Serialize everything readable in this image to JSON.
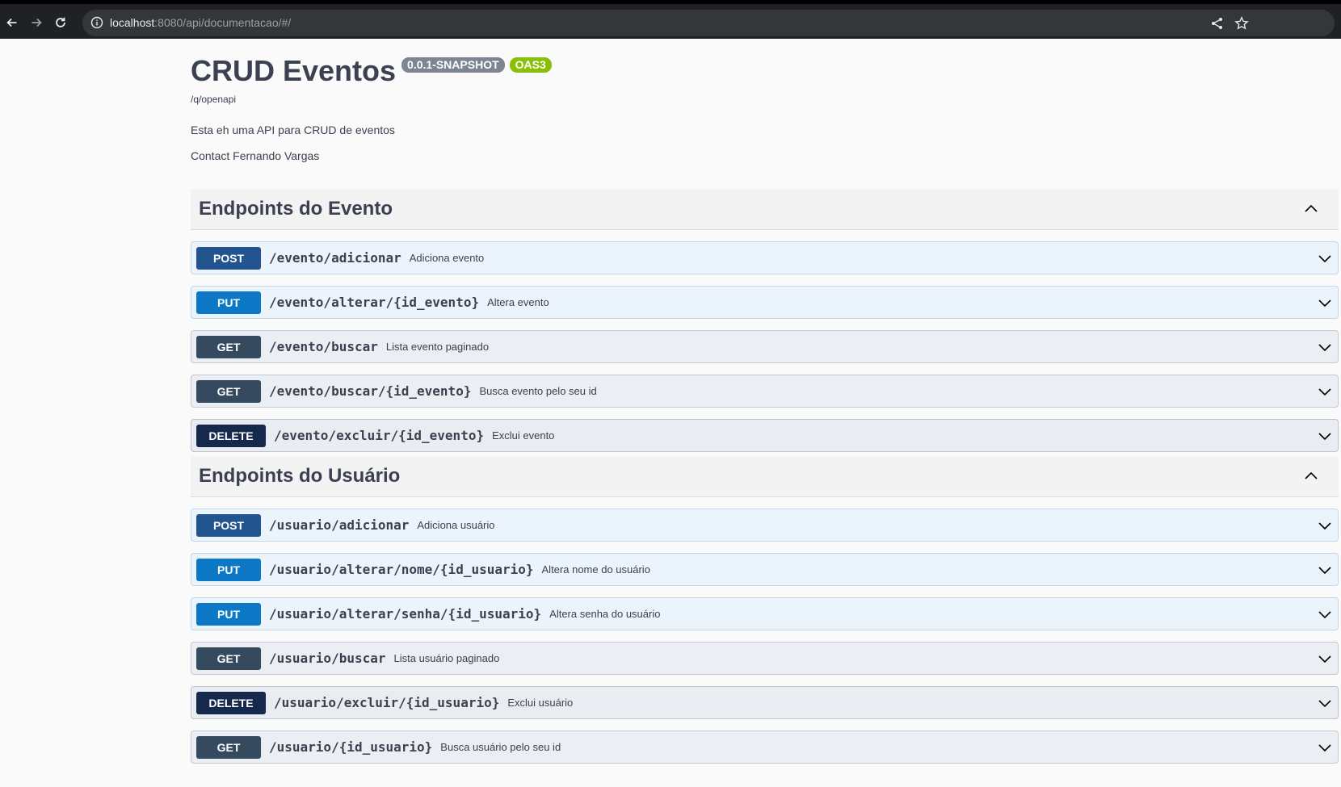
{
  "browser": {
    "url_host": "localhost",
    "url_rest": ":8080/api/documentacao/#/"
  },
  "info": {
    "title": "CRUD Eventos",
    "version_badge": "0.0.1-SNAPSHOT",
    "oas_badge": "OAS3",
    "spec_url": "/q/openapi",
    "description": "Esta eh uma API para CRUD de eventos",
    "contact": "Contact Fernando Vargas"
  },
  "sections": [
    {
      "title": "Endpoints do Evento",
      "operations": [
        {
          "method": "POST",
          "path": "/evento/adicionar",
          "summary": "Adiciona evento"
        },
        {
          "method": "PUT",
          "path": "/evento/alterar/{id_evento}",
          "summary": "Altera evento"
        },
        {
          "method": "GET",
          "path": "/evento/buscar",
          "summary": "Lista evento paginado"
        },
        {
          "method": "GET",
          "path": "/evento/buscar/{id_evento}",
          "summary": "Busca evento pelo seu id"
        },
        {
          "method": "DELETE",
          "path": "/evento/excluir/{id_evento}",
          "summary": "Exclui evento"
        }
      ]
    },
    {
      "title": "Endpoints do Usuário",
      "operations": [
        {
          "method": "POST",
          "path": "/usuario/adicionar",
          "summary": "Adiciona usuário"
        },
        {
          "method": "PUT",
          "path": "/usuario/alterar/nome/{id_usuario}",
          "summary": "Altera nome do usuário"
        },
        {
          "method": "PUT",
          "path": "/usuario/alterar/senha/{id_usuario}",
          "summary": "Altera senha do usuário"
        },
        {
          "method": "GET",
          "path": "/usuario/buscar",
          "summary": "Lista usuário paginado"
        },
        {
          "method": "DELETE",
          "path": "/usuario/excluir/{id_usuario}",
          "summary": "Exclui usuário"
        },
        {
          "method": "GET",
          "path": "/usuario/{id_usuario}",
          "summary": "Busca usuário pelo seu id"
        }
      ]
    }
  ],
  "colors": {
    "post": "#22558f",
    "put": "#0d79c6",
    "get": "#354a5f",
    "delete": "#15294d",
    "version_badge": "#7d8492",
    "oas_badge": "#89bf04"
  }
}
